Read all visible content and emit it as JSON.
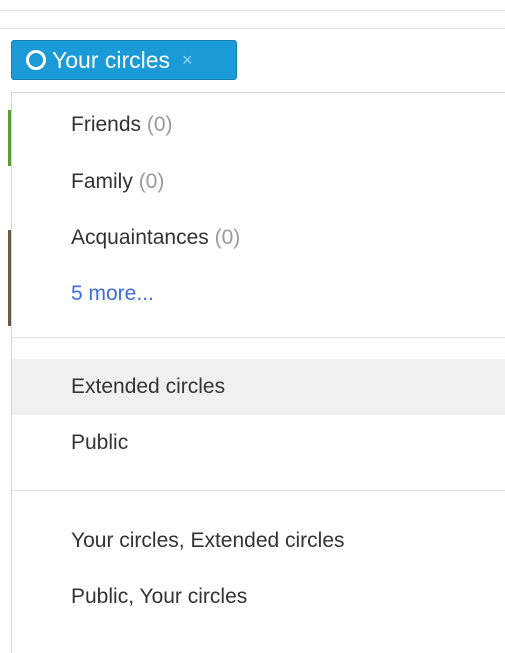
{
  "chip": {
    "label": "Your circles",
    "close": "×",
    "color": "#1a9bd7"
  },
  "menu": {
    "circles": [
      {
        "name": "Friends",
        "count": "(0)"
      },
      {
        "name": "Family",
        "count": "(0)"
      },
      {
        "name": "Acquaintances",
        "count": "(0)"
      }
    ],
    "more_link": "5 more...",
    "scopes": [
      "Extended circles",
      "Public"
    ],
    "combos": [
      "Your circles, Extended circles",
      "Public, Your circles"
    ],
    "highlight_color": "#f0f0f0",
    "link_color": "#3b6dd8"
  }
}
